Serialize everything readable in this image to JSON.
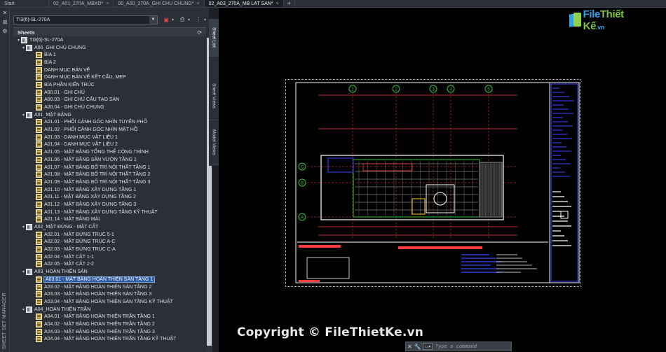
{
  "tabs": [
    {
      "label": "Start",
      "closable": false,
      "active": false
    },
    {
      "label": "02_A01_270A_MBXD*",
      "closable": true,
      "active": false
    },
    {
      "label": "00_A00_270A_GHI CHU CHUNG*",
      "closable": true,
      "active": false
    },
    {
      "label": "02_A03_270A_MB LAT SAN*",
      "closable": true,
      "active": true
    }
  ],
  "tab_close_glyph": "×",
  "tab_new_glyph": "+",
  "palette": {
    "title_vertical": "SHEET SET MANAGER",
    "sheet_set_name": "TI3(6)-SL-270A",
    "sheets_header": "Sheets",
    "vertical_tabs": [
      "Sheet List",
      "Sheet Views",
      "Model Views"
    ]
  },
  "tree": [
    {
      "level": 0,
      "kind": "set",
      "label": "TI3(6)-SL-270A",
      "toggle": "▾"
    },
    {
      "level": 1,
      "kind": "group",
      "label": "A00_GHI CHÚ CHUNG",
      "toggle": "▾"
    },
    {
      "level": 2,
      "kind": "sheet",
      "label": "BÌA 1"
    },
    {
      "level": 2,
      "kind": "sheet",
      "label": "BÌA 2"
    },
    {
      "level": 2,
      "kind": "sheet",
      "label": "DANH MỤC BẢN VẼ"
    },
    {
      "level": 2,
      "kind": "sheet",
      "label": "DANH MỤC BẢN VẼ KẾT CẤU, MEP"
    },
    {
      "level": 2,
      "kind": "sheet",
      "label": "BÌA PHẦN KIẾN TRÚC"
    },
    {
      "level": 2,
      "kind": "sheet",
      "label": "A00.01 - GHI CHÚ"
    },
    {
      "level": 2,
      "kind": "sheet",
      "label": "A00.03 - GHI CHÚ CẤU TẠO SÀN"
    },
    {
      "level": 2,
      "kind": "sheet",
      "label": "A00.04 - GHI CHÚ CHUNG"
    },
    {
      "level": 1,
      "kind": "group",
      "label": "A01_MẶT BẰNG",
      "toggle": "▾"
    },
    {
      "level": 2,
      "kind": "sheet",
      "label": "A01.01 - PHỐI CẢNH GÓC NHÌN TUYẾN PHỐ"
    },
    {
      "level": 2,
      "kind": "sheet",
      "label": "A01.02 - PHỐI CẢNH GÓC NHÌN MẶT HỒ"
    },
    {
      "level": 2,
      "kind": "sheet",
      "label": "A01.03 - DANH MỤC VẬT LIỆU 1"
    },
    {
      "level": 2,
      "kind": "sheet",
      "label": "A01.04 - DANH MỤC VẬT LIỆU 2"
    },
    {
      "level": 2,
      "kind": "sheet",
      "label": "A01.05 - MẶT BẰNG TỔNG THỂ CÔNG TRÌNH"
    },
    {
      "level": 2,
      "kind": "sheet",
      "label": "A01.06 - MẶT BẰNG SÂN VƯỜN TẦNG 1"
    },
    {
      "level": 2,
      "kind": "sheet",
      "label": "A01.07 - MẶT BẰNG BỐ TRÍ NỘI THẤT TẦNG 1"
    },
    {
      "level": 2,
      "kind": "sheet",
      "label": "A01.08 - MẶT BẰNG BỐ TRÍ NỘI THẤT TẦNG 2"
    },
    {
      "level": 2,
      "kind": "sheet",
      "label": "A01.09 - MẶT BẰNG BỐ TRÍ NỘI THẤT TẦNG 3"
    },
    {
      "level": 2,
      "kind": "sheet",
      "label": "A01.10 - MẶT BẰNG XÂY DỰNG TẦNG 1"
    },
    {
      "level": 2,
      "kind": "sheet",
      "label": "A01.11 - MẶT BẰNG XÂY DỰNG TẦNG 2"
    },
    {
      "level": 2,
      "kind": "sheet",
      "label": "A01.12 - MẶT BẰNG XÂY DỰNG TẦNG 3"
    },
    {
      "level": 2,
      "kind": "sheet",
      "label": "A01.13 - MẶT BẰNG XÂY DỰNG TẦNG KỸ THUẬT"
    },
    {
      "level": 2,
      "kind": "sheet",
      "label": "A01.14 - MẶT BẰNG MÁI"
    },
    {
      "level": 1,
      "kind": "group",
      "label": "A02_MẶT ĐỨNG - MẶT CẮT",
      "toggle": "▾"
    },
    {
      "level": 2,
      "kind": "sheet",
      "label": "A02.01 - MẶT ĐỨNG TRỤC 5-1"
    },
    {
      "level": 2,
      "kind": "sheet",
      "label": "A02.02 - MẶT ĐỨNG TRỤC A-C"
    },
    {
      "level": 2,
      "kind": "sheet",
      "label": "A02.03 - MẶT ĐỨNG TRỤC C-A"
    },
    {
      "level": 2,
      "kind": "sheet",
      "label": "A02.04 - MẶT CẮT 1-1"
    },
    {
      "level": 2,
      "kind": "sheet",
      "label": "A02.05 - MẶT CẮT 2-2"
    },
    {
      "level": 1,
      "kind": "group",
      "label": "A03_HOÀN THIỆN SÀN",
      "toggle": "▾"
    },
    {
      "level": 2,
      "kind": "sheet",
      "label": "A03.01 - MẶT BẰNG HOÀN THIỆN SÀN TẦNG 1",
      "selected": true
    },
    {
      "level": 2,
      "kind": "sheet",
      "label": "A03.02 - MẶT BẰNG HOÀN THIỆN SÀN TẦNG 2"
    },
    {
      "level": 2,
      "kind": "sheet",
      "label": "A03.03 - MẶT BẰNG HOÀN THIỆN SÀN TẦNG 3"
    },
    {
      "level": 2,
      "kind": "sheet",
      "label": "A03.04 - MẶT BẰNG HOÀN THIỆN SÀN TẦNG KỸ THUẬT"
    },
    {
      "level": 1,
      "kind": "group",
      "label": "A04_HOÀN THIỆN TRẦN",
      "toggle": "▾"
    },
    {
      "level": 2,
      "kind": "sheet",
      "label": "A04.01 - MẶT BẰNG HOÀN THIỆN TRẦN TẦNG 1"
    },
    {
      "level": 2,
      "kind": "sheet",
      "label": "A04.02 - MẶT BẰNG HOÀN THIỆN TRẦN TẦNG 2"
    },
    {
      "level": 2,
      "kind": "sheet",
      "label": "A04.03 - MẶT BẰNG HOÀN THIỆN TRẦN TẦNG 3"
    },
    {
      "level": 2,
      "kind": "sheet",
      "label": "A04.04 - MẶT BẰNG HOÀN THIỆN TRẦN TẦNG KỸ THUẬT"
    }
  ],
  "drawing": {
    "grid_bubbles_top": [
      "1",
      "2",
      "3",
      "4",
      "5"
    ],
    "grid_bubbles_left": [
      "C",
      "B",
      "A"
    ]
  },
  "logo": {
    "part1": "File",
    "part2": "Thiết Kế",
    "part3": ".vn"
  },
  "watermark": "Copyright © FileThietKe.vn",
  "command": {
    "placeholder": "Type a command"
  },
  "icons": {
    "left_strip": [
      "close-icon",
      "pin-icon",
      "properties-icon"
    ],
    "toolbar": [
      "new-sheet-icon",
      "publish-icon",
      "sheet-selection-icon"
    ],
    "command": [
      "close-icon",
      "wrench-icon",
      "command-prompt-icon"
    ]
  },
  "colors": {
    "accent": "#2c5aa0",
    "grid_green": "#31c231",
    "title_blue": "#3a46ff",
    "dim_red": "#ff3b3b",
    "logo_blue": "#2ea3e8",
    "logo_green": "#7fc242"
  }
}
